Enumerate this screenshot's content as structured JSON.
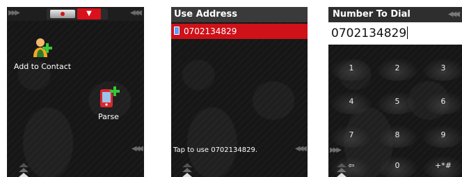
{
  "screen1": {
    "actions": [
      {
        "label": "Add to Contact",
        "icon": "add-contact-icon"
      },
      {
        "label": "Parse",
        "icon": "parse-phone-icon"
      }
    ]
  },
  "screen2": {
    "title": "Use Address",
    "selected_number": "0702134829",
    "status": "Tap to use 0702134829."
  },
  "screen3": {
    "title": "Number To Dial",
    "number": "0702134829",
    "keys": [
      "1",
      "2",
      "3",
      "4",
      "5",
      "6",
      "7",
      "8",
      "9",
      "0",
      "+*#"
    ]
  },
  "colors": {
    "accent": "#cf1119",
    "background": "#161616"
  }
}
